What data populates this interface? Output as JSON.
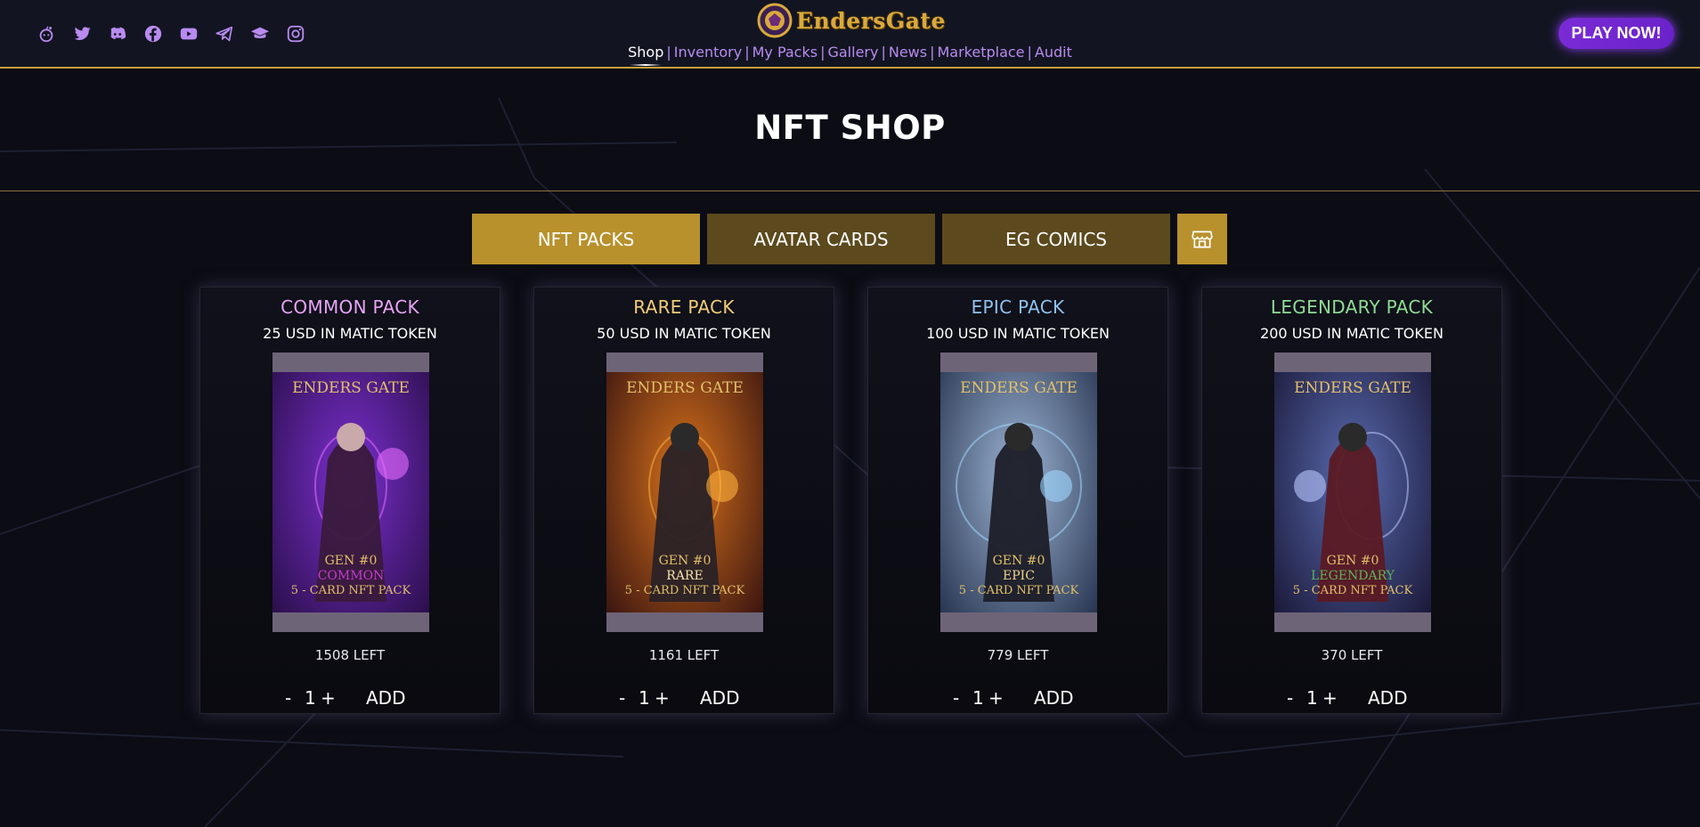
{
  "header": {
    "logo_text": "EndersGate",
    "socials": [
      "reddit-icon",
      "twitter-icon",
      "discord-icon",
      "facebook-icon",
      "youtube-icon",
      "telegram-icon",
      "docs-icon",
      "instagram-icon"
    ],
    "nav": [
      {
        "label": "Shop",
        "active": true
      },
      {
        "label": "Inventory",
        "active": false
      },
      {
        "label": "My Packs",
        "active": false
      },
      {
        "label": "Gallery",
        "active": false
      },
      {
        "label": "News",
        "active": false
      },
      {
        "label": "Marketplace",
        "active": false
      },
      {
        "label": "Audit",
        "active": false
      }
    ],
    "nav_separator": "|",
    "play_label": "PLAY NOW!"
  },
  "page_title": "NFT SHOP",
  "tabs": [
    {
      "label": "NFT PACKS",
      "active": true
    },
    {
      "label": "AVATAR CARDS",
      "active": false
    },
    {
      "label": "EG COMICS",
      "active": false
    }
  ],
  "store_icon": "store-icon",
  "packs": [
    {
      "name": "COMMON PACK",
      "price": "25 USD IN MATIC TOKEN",
      "left": "1508 LEFT",
      "qty": "1",
      "minus": "-",
      "plus": "+",
      "add": "ADD",
      "color": "#e7a4f5",
      "pack_brand": "ENDERS GATE",
      "pack_gen": "GEN #0",
      "pack_rarity": "COMMON",
      "pack_desc": "5 - CARD NFT PACK",
      "rarity_color": "#c13bd0"
    },
    {
      "name": "RARE PACK",
      "price": "50 USD IN MATIC TOKEN",
      "left": "1161 LEFT",
      "qty": "1",
      "minus": "-",
      "plus": "+",
      "add": "ADD",
      "color": "#f2cd78",
      "pack_brand": "ENDERS GATE",
      "pack_gen": "GEN #0",
      "pack_rarity": "RARE",
      "pack_desc": "5 - CARD NFT PACK",
      "rarity_color": "#f4e2a8"
    },
    {
      "name": "EPIC PACK",
      "price": "100 USD IN MATIC TOKEN",
      "left": "779 LEFT",
      "qty": "1",
      "minus": "-",
      "plus": "+",
      "add": "ADD",
      "color": "#8fc2ee",
      "pack_brand": "ENDERS GATE",
      "pack_gen": "GEN #0",
      "pack_rarity": "EPIC",
      "pack_desc": "5 - CARD NFT PACK",
      "rarity_color": "#f0d48a"
    },
    {
      "name": "LEGENDARY PACK",
      "price": "200 USD IN MATIC TOKEN",
      "left": "370 LEFT",
      "qty": "1",
      "minus": "-",
      "plus": "+",
      "add": "ADD",
      "color": "#8fdc95",
      "pack_brand": "ENDERS GATE",
      "pack_gen": "GEN #0",
      "pack_rarity": "LEGENDARY",
      "pack_desc": "5 - CARD NFT PACK",
      "rarity_color": "#5fb25a"
    }
  ],
  "colors": {
    "accent_gold": "#b8912d",
    "tab_inactive": "#5c4a1e",
    "play_purple": "#7a2bd6",
    "nav_link": "#b98bf0"
  }
}
